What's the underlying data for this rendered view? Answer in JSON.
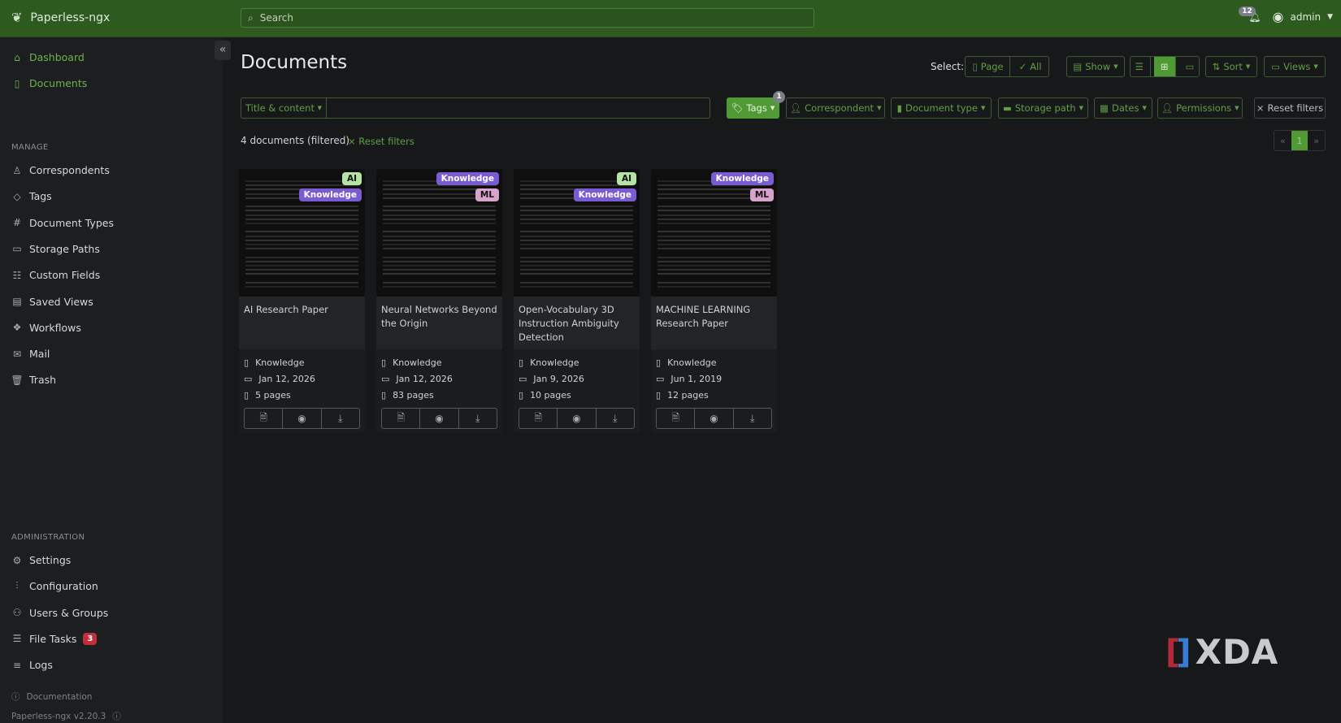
{
  "app": {
    "name": "Paperless-ngx",
    "search_placeholder": "Search",
    "notifications": "12",
    "user": "admin"
  },
  "sidebar": {
    "items": [
      {
        "label": "Dashboard",
        "icon": "house-icon"
      },
      {
        "label": "Documents",
        "icon": "file-icon"
      }
    ],
    "manage_title": "MANAGE",
    "manage": [
      {
        "label": "Correspondents",
        "icon": "person-icon"
      },
      {
        "label": "Tags",
        "icon": "tag-icon"
      },
      {
        "label": "Document Types",
        "icon": "hash-icon"
      },
      {
        "label": "Storage Paths",
        "icon": "folder-icon"
      },
      {
        "label": "Custom Fields",
        "icon": "ui-radios-icon"
      },
      {
        "label": "Saved Views",
        "icon": "window-stack-icon"
      },
      {
        "label": "Workflows",
        "icon": "boxes-icon"
      },
      {
        "label": "Mail",
        "icon": "envelope-icon"
      },
      {
        "label": "Trash",
        "icon": "trash-icon"
      }
    ],
    "admin_title": "ADMINISTRATION",
    "admin": [
      {
        "label": "Settings",
        "icon": "gear-icon"
      },
      {
        "label": "Configuration",
        "icon": "sliders-icon"
      },
      {
        "label": "Users & Groups",
        "icon": "people-icon"
      },
      {
        "label": "File Tasks",
        "icon": "list-task-icon",
        "badge": "3"
      },
      {
        "label": "Logs",
        "icon": "text-left-icon"
      }
    ],
    "documentation": "Documentation",
    "version": "Paperless-ngx v2.20.3"
  },
  "main": {
    "title": "Documents",
    "select_label": "Select:",
    "select_page": "Page",
    "select_all": "All",
    "show": "Show",
    "sort": "Sort",
    "views": "Views",
    "title_content": "Title & content",
    "filters": {
      "tags": "Tags",
      "tags_count": "1",
      "correspondent": "Correspondent",
      "document_type": "Document type",
      "storage_path": "Storage path",
      "dates": "Dates",
      "permissions": "Permissions",
      "reset": "Reset filters"
    },
    "count": "4 documents (filtered)",
    "reset_link": "Reset filters",
    "pager": {
      "prev": "«",
      "current": "1",
      "next": "»"
    }
  },
  "tag_colors": {
    "AI": {
      "bg": "#b5e3a5",
      "fg": "#111"
    },
    "Knowledge": {
      "bg": "#7a5bd1",
      "fg": "#fff"
    },
    "ML": {
      "bg": "#d7a3c9",
      "fg": "#111"
    }
  },
  "documents": [
    {
      "title": "AI Research Paper",
      "tags": [
        "AI",
        "Knowledge"
      ],
      "type": "Knowledge",
      "date": "Jan 12, 2026",
      "pages": "5 pages"
    },
    {
      "title": "Neural Networks Beyond the Origin",
      "tags": [
        "Knowledge",
        "ML"
      ],
      "type": "Knowledge",
      "date": "Jan 12, 2026",
      "pages": "83 pages"
    },
    {
      "title": "Open-Vocabulary 3D Instruction Ambiguity Detection",
      "tags": [
        "AI",
        "Knowledge"
      ],
      "type": "Knowledge",
      "date": "Jan 9, 2026",
      "pages": "10 pages"
    },
    {
      "title": "MACHINE LEARNING Research Paper",
      "tags": [
        "Knowledge",
        "ML"
      ],
      "type": "Knowledge",
      "date": "Jun 1, 2019",
      "pages": "12 pages"
    }
  ],
  "watermark": "XDA"
}
